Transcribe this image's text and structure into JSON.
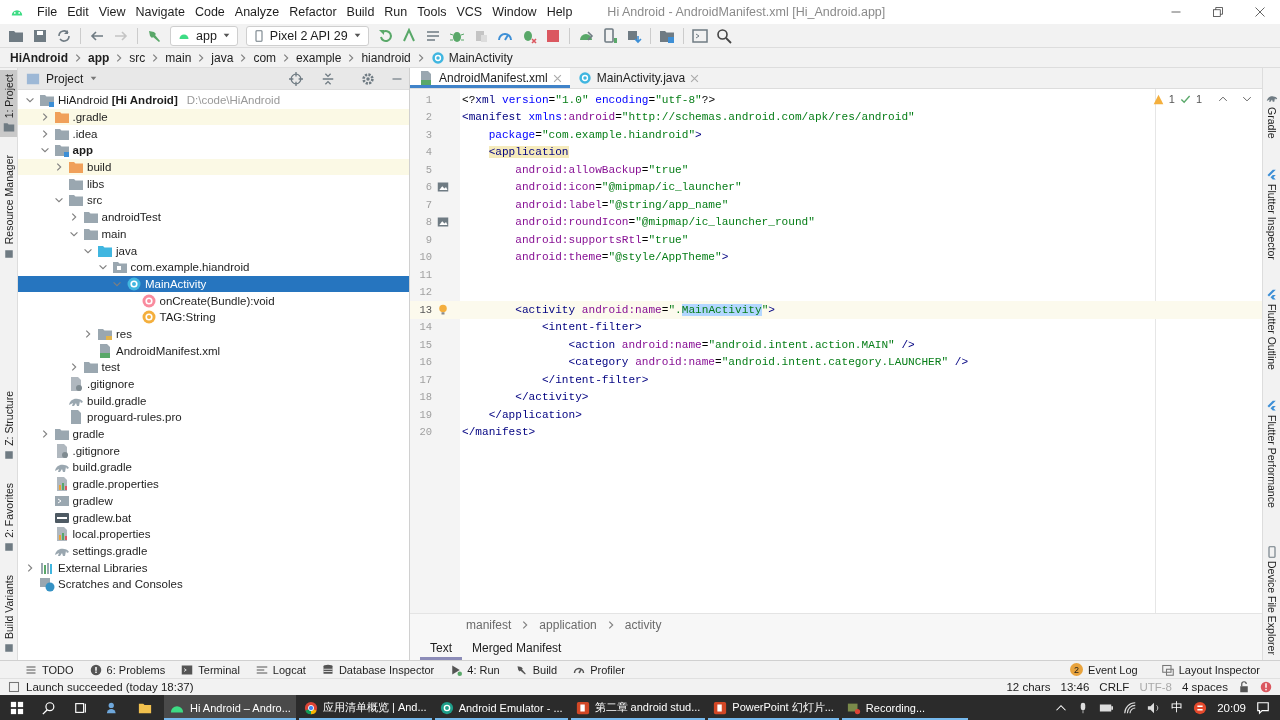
{
  "window": {
    "title": "Hi Android - AndroidManifest.xml [Hi_Android.app]",
    "menus": [
      "File",
      "Edit",
      "View",
      "Navigate",
      "Code",
      "Analyze",
      "Refactor",
      "Build",
      "Run",
      "Tools",
      "VCS",
      "Window",
      "Help"
    ]
  },
  "toolbar": {
    "run_config": "app",
    "device": "Pixel 2 API 29"
  },
  "navigation_bar": [
    {
      "label": "HiAndroid",
      "kind": "project"
    },
    {
      "label": "app",
      "kind": "module"
    },
    {
      "label": "src",
      "kind": "folder"
    },
    {
      "label": "main",
      "kind": "folder"
    },
    {
      "label": "java",
      "kind": "folder"
    },
    {
      "label": "com",
      "kind": "folder"
    },
    {
      "label": "example",
      "kind": "folder"
    },
    {
      "label": "hiandroid",
      "kind": "folder"
    },
    {
      "label": "MainActivity",
      "kind": "class"
    }
  ],
  "left_stripe": {
    "top": [
      {
        "label": "1: Project",
        "selected": true
      },
      {
        "label": "Resource Manager",
        "selected": false
      }
    ],
    "bottom": [
      {
        "label": "Z: Structure",
        "selected": false
      },
      {
        "label": "2: Favorites",
        "selected": false
      },
      {
        "label": "Build Variants",
        "selected": false
      }
    ]
  },
  "project": {
    "title": "Project",
    "tree": [
      {
        "label": "HiAndroid **[Hi Android]**",
        "path": "D:\\code\\HiAndroid",
        "kind": "project",
        "expanded": true,
        "selected": false,
        "excluded": false,
        "children": [
          {
            "label": ".gradle",
            "kind": "folder-excluded",
            "expanded": false,
            "selected": false,
            "excluded": true
          },
          {
            "label": ".idea",
            "kind": "folder",
            "expanded": false,
            "selected": false,
            "excluded": false
          },
          {
            "label": "app",
            "kind": "module",
            "expanded": true,
            "selected": false,
            "excluded": false,
            "children": [
              {
                "label": "build",
                "kind": "folder-excluded",
                "expanded": false,
                "selected": false,
                "excluded": true
              },
              {
                "label": "libs",
                "kind": "folder",
                "selected": false,
                "excluded": false
              },
              {
                "label": "src",
                "kind": "folder",
                "expanded": true,
                "selected": false,
                "excluded": false,
                "children": [
                  {
                    "label": "androidTest",
                    "kind": "folder",
                    "expanded": false,
                    "selected": false,
                    "excluded": false
                  },
                  {
                    "label": "main",
                    "kind": "folder",
                    "expanded": true,
                    "selected": false,
                    "excluded": false,
                    "children": [
                      {
                        "label": "java",
                        "kind": "source-folder",
                        "expanded": true,
                        "selected": false,
                        "excluded": false,
                        "children": [
                          {
                            "label": "com.example.hiandroid",
                            "kind": "package",
                            "expanded": true,
                            "selected": false,
                            "excluded": false,
                            "children": [
                              {
                                "label": "MainActivity",
                                "kind": "class",
                                "expanded": true,
                                "selected": true,
                                "excluded": false,
                                "children": [
                                  {
                                    "label": "onCreate(Bundle):void",
                                    "kind": "method",
                                    "selected": false,
                                    "excluded": false
                                  },
                                  {
                                    "label": "TAG:String",
                                    "kind": "field",
                                    "selected": false,
                                    "excluded": false
                                  }
                                ]
                              }
                            ]
                          }
                        ]
                      },
                      {
                        "label": "res",
                        "kind": "res-folder",
                        "expanded": false,
                        "selected": false,
                        "excluded": false
                      },
                      {
                        "label": "AndroidManifest.xml",
                        "kind": "manifest",
                        "selected": false,
                        "excluded": false
                      }
                    ]
                  },
                  {
                    "label": "test",
                    "kind": "folder",
                    "expanded": false,
                    "selected": false,
                    "excluded": false
                  }
                ]
              },
              {
                "label": ".gitignore",
                "kind": "ignore-file",
                "selected": false,
                "excluded": false
              },
              {
                "label": "build.gradle",
                "kind": "gradle-file",
                "selected": false,
                "excluded": false
              },
              {
                "label": "proguard-rules.pro",
                "kind": "file",
                "selected": false,
                "excluded": false
              }
            ]
          },
          {
            "label": "gradle",
            "kind": "folder",
            "expanded": false,
            "selected": false,
            "excluded": false
          },
          {
            "label": ".gitignore",
            "kind": "ignore-file",
            "selected": false,
            "excluded": false
          },
          {
            "label": "build.gradle",
            "kind": "gradle-file",
            "selected": false,
            "excluded": false
          },
          {
            "label": "gradle.properties",
            "kind": "properties-file",
            "selected": false,
            "excluded": false
          },
          {
            "label": "gradlew",
            "kind": "script-file",
            "selected": false,
            "excluded": false
          },
          {
            "label": "gradlew.bat",
            "kind": "bat-file",
            "selected": false,
            "excluded": false
          },
          {
            "label": "local.properties",
            "kind": "properties-file",
            "selected": false,
            "excluded": false
          },
          {
            "label": "settings.gradle",
            "kind": "gradle-file",
            "selected": false,
            "excluded": false
          }
        ]
      },
      {
        "label": "External Libraries",
        "kind": "libraries",
        "expanded": false,
        "selected": false,
        "excluded": false
      },
      {
        "label": "Scratches and Consoles",
        "kind": "scratches",
        "selected": false,
        "excluded": false
      }
    ]
  },
  "editor": {
    "tabs": [
      {
        "label": "AndroidManifest.xml",
        "kind": "manifest",
        "selected": true
      },
      {
        "label": "MainActivity.java",
        "kind": "class",
        "selected": false
      }
    ],
    "inspections": {
      "warnings": "1",
      "weak_warnings": "1"
    },
    "lines": [
      {
        "number": "1",
        "current": false,
        "segments": [
          {
            "kind": "punct",
            "text": "<?"
          },
          {
            "kind": "tag",
            "text": "xml"
          },
          {
            "kind": "attr",
            "text": " version"
          },
          {
            "kind": "punct",
            "text": "="
          },
          {
            "kind": "value",
            "text": "\"1.0\""
          },
          {
            "kind": "attr",
            "text": " encoding"
          },
          {
            "kind": "punct",
            "text": "="
          },
          {
            "kind": "value",
            "text": "\"utf-8\""
          },
          {
            "kind": "punct",
            "text": "?>"
          }
        ]
      },
      {
        "number": "2",
        "current": false,
        "segments": [
          {
            "kind": "tag",
            "text": "<manifest"
          },
          {
            "kind": "attr",
            "text": " xmlns"
          },
          {
            "kind": "ns",
            "text": ":android"
          },
          {
            "kind": "punct",
            "text": "="
          },
          {
            "kind": "value",
            "text": "\"http://schemas.android.com/apk/res/android\""
          }
        ]
      },
      {
        "number": "3",
        "current": false,
        "segments": [
          {
            "kind": "attr",
            "text": "    package"
          },
          {
            "kind": "punct",
            "text": "="
          },
          {
            "kind": "value",
            "text": "\"com.example.hiandroid\""
          },
          {
            "kind": "tag",
            "text": ">"
          }
        ]
      },
      {
        "number": "4",
        "current": false,
        "segments": [
          {
            "kind": "match",
            "text": "    <application"
          }
        ]
      },
      {
        "number": "5",
        "current": false,
        "segments": [
          {
            "kind": "ns",
            "text": "        android:allowBackup"
          },
          {
            "kind": "punct",
            "text": "="
          },
          {
            "kind": "value",
            "text": "\"true\""
          }
        ]
      },
      {
        "number": "6",
        "current": false,
        "gutter": {
          "kind": "image"
        },
        "segments": [
          {
            "kind": "ns",
            "text": "        android:icon"
          },
          {
            "kind": "punct",
            "text": "="
          },
          {
            "kind": "value",
            "text": "\"@mipmap/ic_launcher\""
          }
        ]
      },
      {
        "number": "7",
        "current": false,
        "segments": [
          {
            "kind": "ns",
            "text": "        android:label"
          },
          {
            "kind": "punct",
            "text": "="
          },
          {
            "kind": "value",
            "text": "\"@string/app_name\""
          }
        ]
      },
      {
        "number": "8",
        "current": false,
        "gutter": {
          "kind": "image"
        },
        "segments": [
          {
            "kind": "ns",
            "text": "        android:roundIcon"
          },
          {
            "kind": "punct",
            "text": "="
          },
          {
            "kind": "value",
            "text": "\"@mipmap/ic_launcher_round\""
          }
        ]
      },
      {
        "number": "9",
        "current": false,
        "segments": [
          {
            "kind": "ns",
            "text": "        android:supportsRtl"
          },
          {
            "kind": "punct",
            "text": "="
          },
          {
            "kind": "value",
            "text": "\"true\""
          }
        ]
      },
      {
        "number": "10",
        "current": false,
        "segments": [
          {
            "kind": "ns",
            "text": "        android:theme"
          },
          {
            "kind": "punct",
            "text": "="
          },
          {
            "kind": "value",
            "text": "\"@style/AppTheme\""
          },
          {
            "kind": "tag",
            "text": ">"
          }
        ]
      },
      {
        "number": "11",
        "current": false
      },
      {
        "number": "12",
        "current": false
      },
      {
        "number": "13",
        "current": true,
        "gutter": {
          "kind": "bulb"
        },
        "segments": [
          {
            "kind": "tag",
            "text": "        <activity"
          },
          {
            "kind": "ns",
            "text": " android:name"
          },
          {
            "kind": "punct",
            "text": "="
          },
          {
            "kind": "value",
            "text": "\"."
          },
          {
            "kind": "selection",
            "text": "MainActivity"
          },
          {
            "kind": "value",
            "text": "\""
          },
          {
            "kind": "tag",
            "text": ">"
          }
        ]
      },
      {
        "number": "14",
        "current": false,
        "segments": [
          {
            "kind": "tag",
            "text": "            <intent-filter>"
          }
        ]
      },
      {
        "number": "15",
        "current": false,
        "segments": [
          {
            "kind": "tag",
            "text": "                <action"
          },
          {
            "kind": "ns",
            "text": " android:name"
          },
          {
            "kind": "punct",
            "text": "="
          },
          {
            "kind": "value",
            "text": "\"android.intent.action.MAIN\""
          },
          {
            "kind": "tag",
            "text": " />"
          }
        ]
      },
      {
        "number": "16",
        "current": false,
        "segments": [
          {
            "kind": "tag",
            "text": "                <category"
          },
          {
            "kind": "ns",
            "text": " android:name"
          },
          {
            "kind": "punct",
            "text": "="
          },
          {
            "kind": "value",
            "text": "\"android.intent.category.LAUNCHER\""
          },
          {
            "kind": "tag",
            "text": " />"
          }
        ]
      },
      {
        "number": "17",
        "current": false,
        "segments": [
          {
            "kind": "tag",
            "text": "            </intent-filter>"
          }
        ]
      },
      {
        "number": "18",
        "current": false,
        "segments": [
          {
            "kind": "tag",
            "text": "        </activity>"
          }
        ]
      },
      {
        "number": "19",
        "current": false,
        "segments": [
          {
            "kind": "tag",
            "text": "    </application>"
          }
        ]
      },
      {
        "number": "20",
        "current": false,
        "segments": [
          {
            "kind": "tag",
            "text": "</manifest>"
          }
        ]
      }
    ],
    "breadcrumbs": [
      "manifest",
      "application",
      "activity"
    ],
    "view_tabs": [
      {
        "label": "Text",
        "selected": true
      },
      {
        "label": "Merged Manifest",
        "selected": false
      }
    ]
  },
  "right_stripe": {
    "top": [
      {
        "label": "Gradle",
        "kind": "gradle"
      },
      {
        "label": "Flutter Inspector",
        "kind": "flutter"
      },
      {
        "label": "Flutter Outline",
        "kind": "flutter"
      },
      {
        "label": "Flutter Performance",
        "kind": "flutter"
      }
    ],
    "bottom": [
      {
        "label": "Device File Explorer",
        "kind": "device"
      }
    ]
  },
  "tool_windows": {
    "left": [
      {
        "label": "TODO",
        "kind": "todo"
      },
      {
        "label": "6: Problems",
        "kind": "problems"
      },
      {
        "label": "Terminal",
        "kind": "terminal"
      },
      {
        "label": "Logcat",
        "kind": "logcat"
      },
      {
        "label": "Database Inspector",
        "kind": "database"
      },
      {
        "label": "4: Run",
        "kind": "run"
      },
      {
        "label": "Build",
        "kind": "build"
      },
      {
        "label": "Profiler",
        "kind": "profiler"
      }
    ],
    "right": [
      {
        "label": "Event Log",
        "kind": "event-log",
        "badge": "2"
      },
      {
        "label": "Layout Inspector",
        "kind": "layout"
      }
    ]
  },
  "status_bar": {
    "message": "Launch succeeded (today 18:37)",
    "items": [
      {
        "label": "12 chars",
        "disabled": false
      },
      {
        "label": "13:46",
        "disabled": false
      },
      {
        "label": "CRLF",
        "disabled": false
      },
      {
        "label": "UTF-8",
        "disabled": true
      },
      {
        "label": "4 spaces",
        "disabled": false
      }
    ]
  },
  "taskbar": {
    "tasks": [
      {
        "label": "Hi Android – Andro...",
        "kind": "android",
        "selected": true
      },
      {
        "label": "应用清单概览 | And...",
        "kind": "browser",
        "selected": false
      },
      {
        "label": "Android Emulator - ...",
        "kind": "emulator",
        "selected": false
      },
      {
        "label": "第二章 android stud...",
        "kind": "slides",
        "selected": false
      },
      {
        "label": "PowerPoint 幻灯片...",
        "kind": "slides",
        "selected": false
      },
      {
        "label": "Recording...",
        "kind": "recorder",
        "selected": false
      }
    ],
    "input_method": "中",
    "clock": "20:09"
  }
}
